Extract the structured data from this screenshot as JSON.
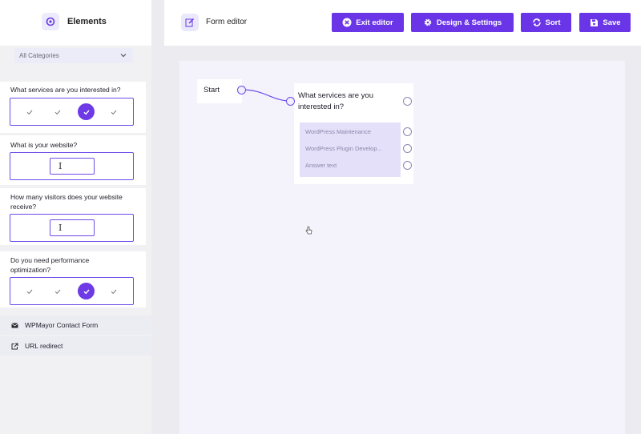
{
  "sidebar": {
    "title": "Elements",
    "category_select": "All Categories",
    "questions": [
      {
        "label": "What services are you interested in?",
        "type": "checks",
        "selected": 3
      },
      {
        "label": "What is your website?",
        "type": "text"
      },
      {
        "label": "How many visitors does your website receive?",
        "type": "text"
      },
      {
        "label": "Do you need performance optimization?",
        "type": "checks",
        "selected": 3
      }
    ],
    "links": [
      {
        "label": "WPMayor Contact Form",
        "icon": "envelope-icon"
      },
      {
        "label": "URL redirect",
        "icon": "external-link-icon"
      }
    ]
  },
  "header": {
    "title": "Form editor",
    "buttons": {
      "exit": "Exit editor",
      "design": "Design & Settings",
      "sort": "Sort",
      "save": "Save"
    }
  },
  "canvas": {
    "start_label": "Start",
    "question_node": {
      "title": "What services are you interested in?",
      "answers": [
        "WordPress Maintenance",
        "WordPress Plugin Develop...",
        "Answer text"
      ]
    }
  },
  "colors": {
    "accent": "#6935e6",
    "canvas_bg": "#f4f3fc",
    "answer_bg": "#e5e0fa"
  }
}
